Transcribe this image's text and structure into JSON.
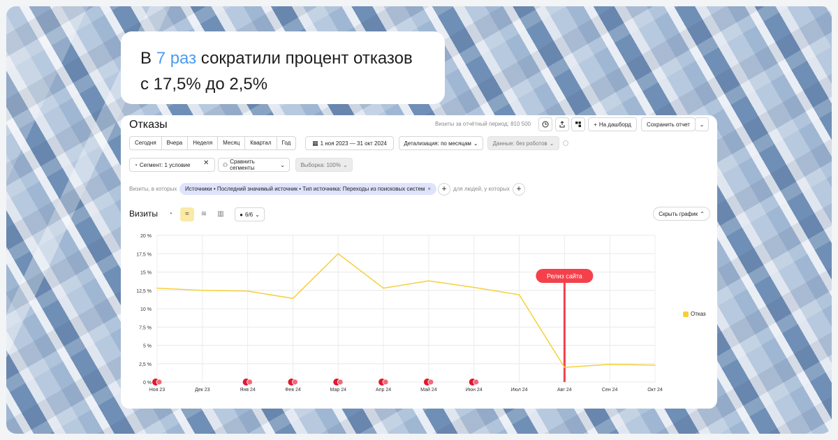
{
  "headline": {
    "prefix": "В ",
    "accent": "7 раз",
    "rest": " сократили процент отказов",
    "line2": "с 17,5% до 2,5%"
  },
  "report": {
    "title": "Отказы",
    "visits_note": "Визиты за отчётный период: 810 500",
    "to_dashboard": "На дашборд",
    "save_report": "Сохранить отчет"
  },
  "periods": [
    "Сегодня",
    "Вчера",
    "Неделя",
    "Месяц",
    "Квартал",
    "Год"
  ],
  "date_range": "1 ноя 2023 — 31 окт 2024",
  "detail": "Детализация: по месяцам",
  "data_filter": "Данные: без роботов",
  "segment": "Сегмент: 1 условие",
  "compare": "Сравнить сегменты",
  "sample": "Выборка: 100%",
  "filter": {
    "prefix": "Визиты, в которых",
    "chip": "Источники • Последний значимый источник • Тип источника: Переходы из поисковых систем",
    "suffix": "для людей, у которых"
  },
  "chart_header": {
    "title": "Визиты",
    "series_count": "6/6",
    "hide_chart": "Скрыть график"
  },
  "colors": {
    "line": "#f5d03a",
    "release": "#f5404c",
    "accent": "#4b9cf0"
  },
  "chart_data": {
    "type": "line",
    "categories": [
      "Ноя 23",
      "Дек 23",
      "Янв 24",
      "Фев 24",
      "Мар 24",
      "Апр 24",
      "Май 24",
      "Июн 24",
      "Июл 24",
      "Авг 24",
      "Сен 24",
      "Окт 24"
    ],
    "series": [
      {
        "name": "Отказ",
        "values": [
          12.8,
          12.5,
          12.4,
          11.4,
          17.5,
          12.8,
          13.8,
          12.9,
          11.9,
          2.0,
          2.4,
          2.3
        ]
      }
    ],
    "ylim": [
      0,
      20
    ],
    "yticks": [
      "0 %",
      "2,5 %",
      "5 %",
      "7,5 %",
      "10 %",
      "12,5 %",
      "15 %",
      "17,5 %",
      "20 %"
    ],
    "grid": true,
    "legend_position": "right",
    "annotation": {
      "label": "Релиз сайта",
      "category": "Авг 24"
    },
    "event_markers": [
      "Ноя 23",
      "Янв 24",
      "Фев 24",
      "Мар 24",
      "Апр 24",
      "Май 24",
      "Июн 24"
    ]
  }
}
